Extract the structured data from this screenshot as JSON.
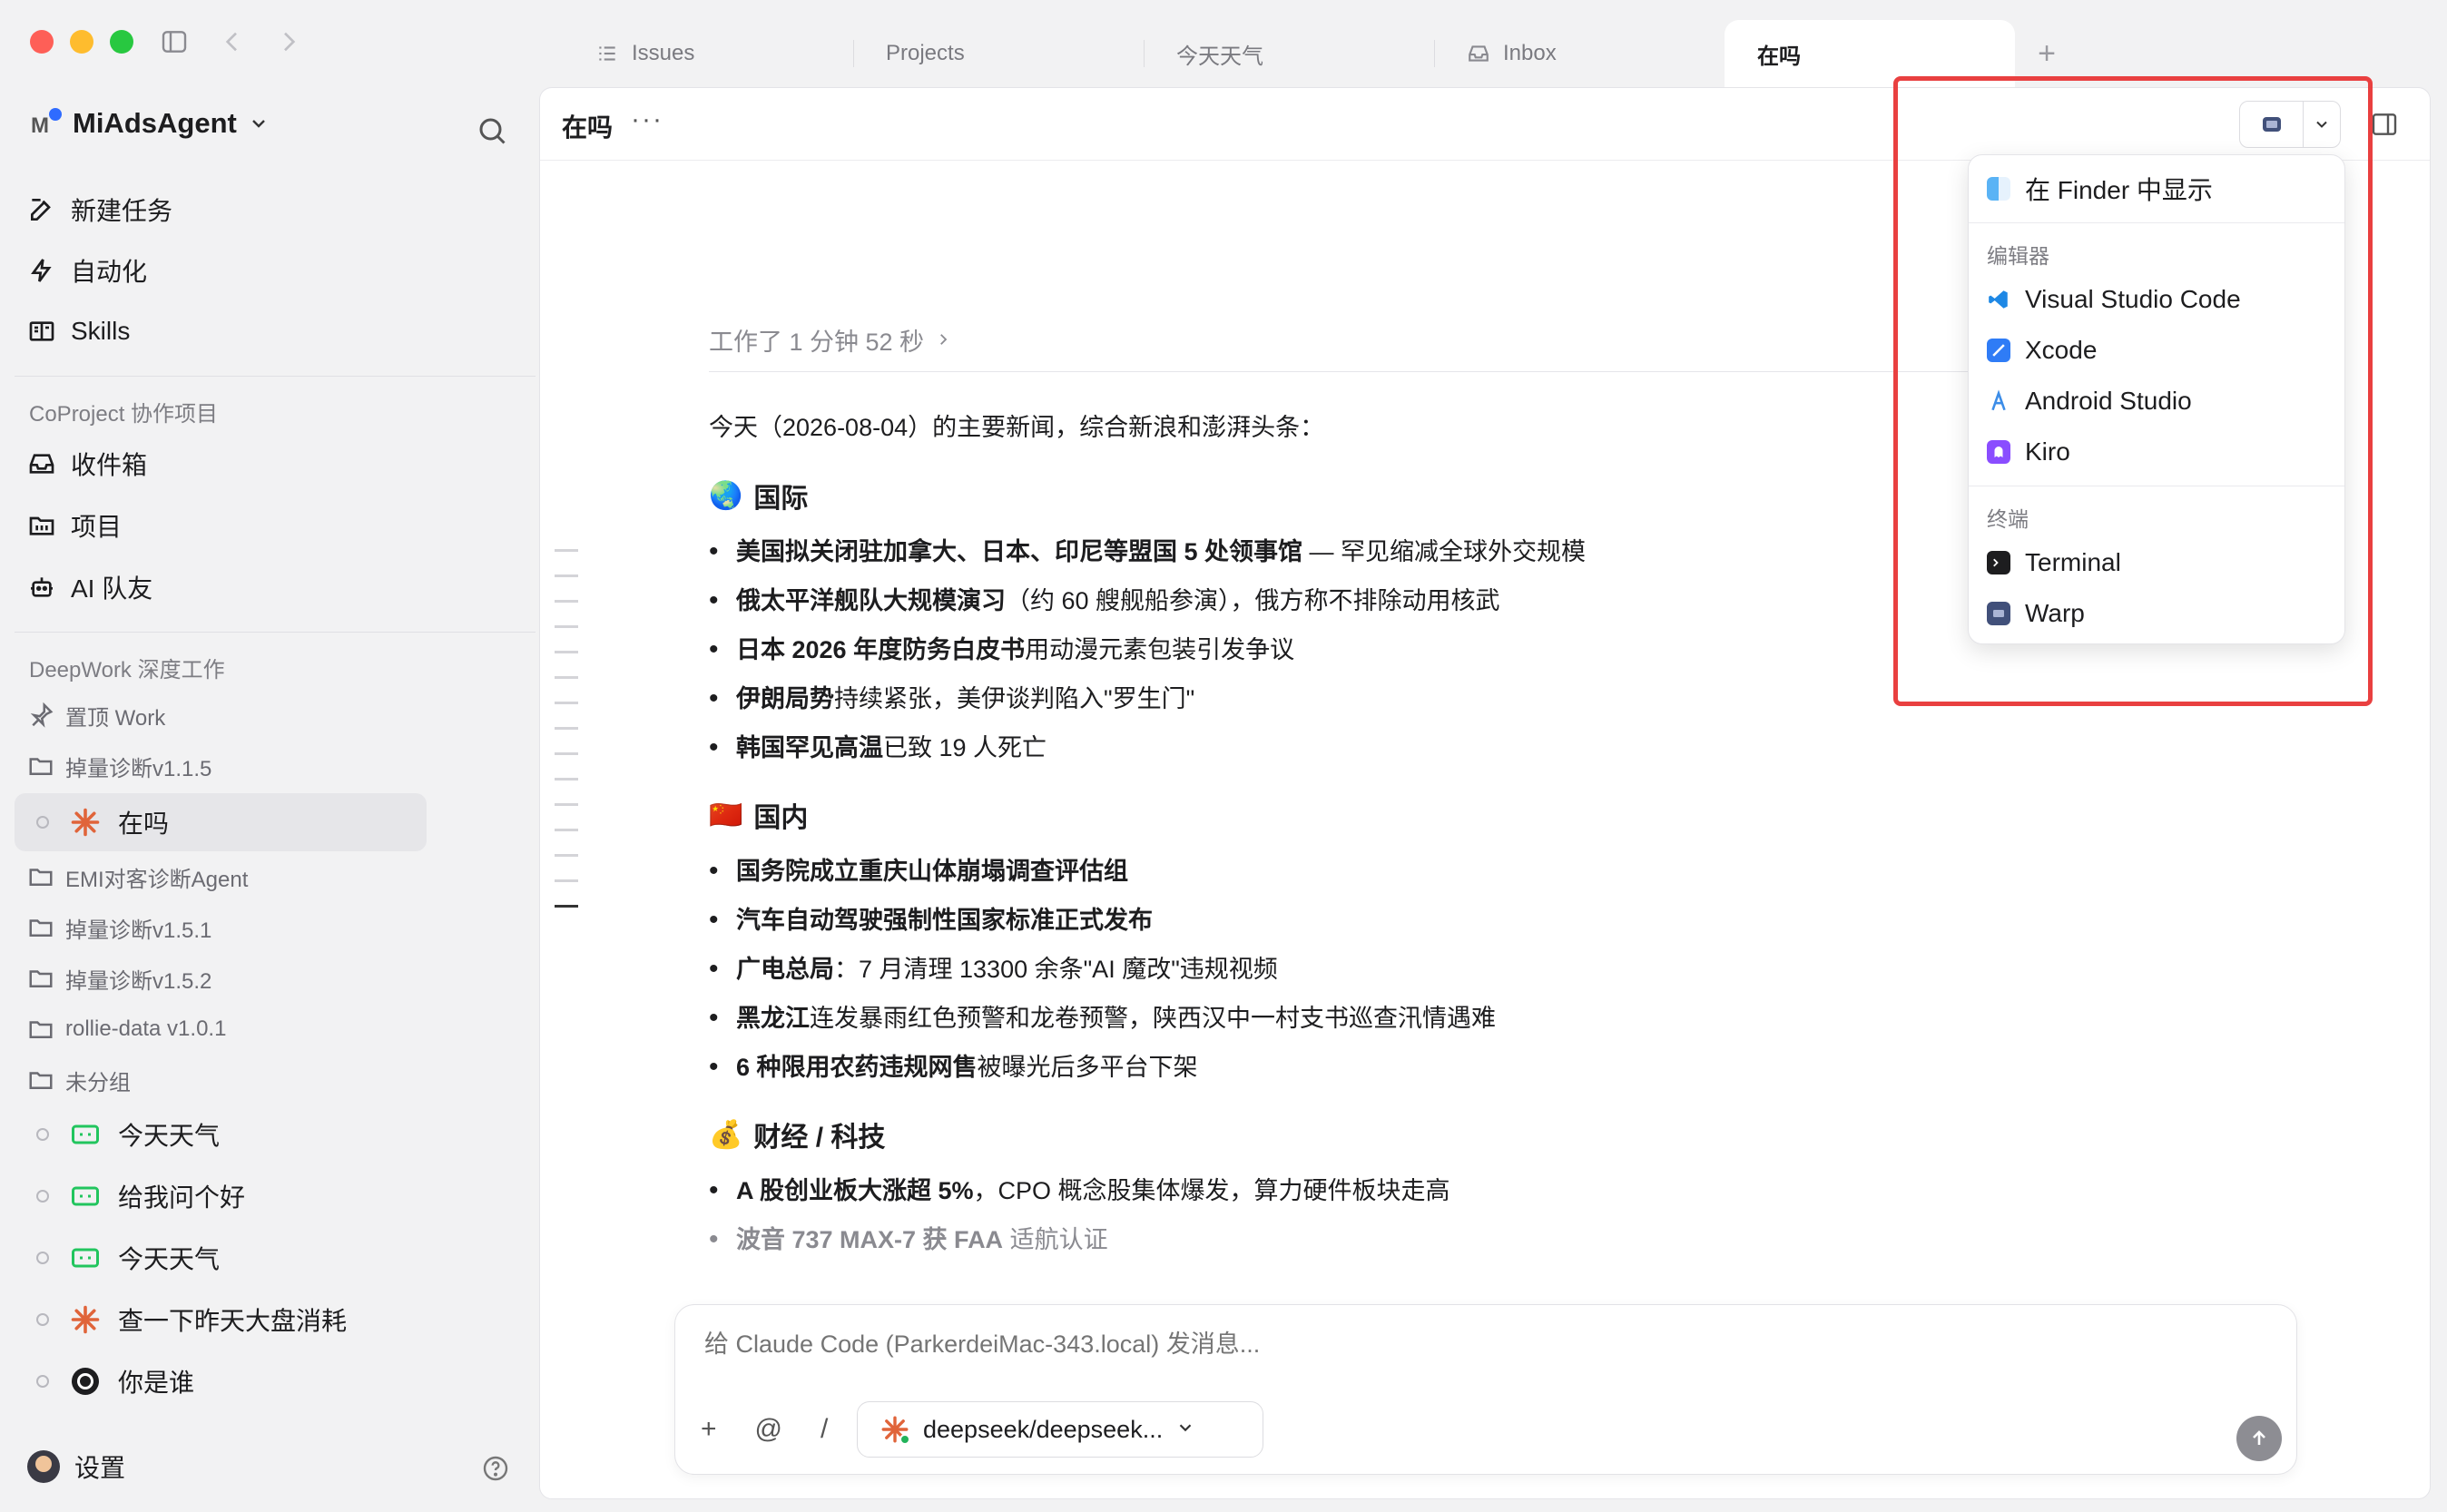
{
  "tabs": [
    {
      "label": "Issues",
      "icon": "list-icon"
    },
    {
      "label": "Projects",
      "icon": ""
    },
    {
      "label": "今天天气",
      "icon": ""
    },
    {
      "label": "Inbox",
      "icon": "inbox-icon"
    },
    {
      "label": "在吗",
      "icon": "",
      "active": true
    }
  ],
  "tab_add": "+",
  "sidebar": {
    "workspace_logo": "M",
    "workspace_name": "MiAdsAgent",
    "nav": [
      {
        "label": "新建任务",
        "icon": "edit-icon"
      },
      {
        "label": "自动化",
        "icon": "bolt-icon"
      },
      {
        "label": "Skills",
        "icon": "book-icon"
      }
    ],
    "coproject_label": "CoProject 协作项目",
    "coproject": [
      {
        "label": "收件箱",
        "icon": "inbox-icon"
      },
      {
        "label": "项目",
        "icon": "folder-grid-icon"
      },
      {
        "label": "AI 队友",
        "icon": "robot-icon"
      }
    ],
    "deepwork_label": "DeepWork 深度工作",
    "pinned": "置顶 Work",
    "groups_top": [
      "掉量诊断v1.1.5"
    ],
    "selected_chat": "在吗",
    "groups": [
      "EMI对客诊断Agent",
      "掉量诊断v1.5.1",
      "掉量诊断v1.5.2",
      "rollie-data v1.0.1",
      "未分组"
    ],
    "chats": [
      {
        "label": "今天天气",
        "icon": "bot-green-icon"
      },
      {
        "label": "给我问个好",
        "icon": "bot-green-icon"
      },
      {
        "label": "今天天气",
        "icon": "bot-green-icon"
      },
      {
        "label": "查一下昨天大盘消耗",
        "icon": "claude-icon"
      },
      {
        "label": "你是谁",
        "icon": "openai-icon"
      }
    ],
    "settings": "设置"
  },
  "main": {
    "title": "在吗",
    "more": "···",
    "worked": "工作了 1 分钟 52 秒",
    "intro": "今天（2026-08-04）的主要新闻，综合新浪和澎湃头条：",
    "sections": [
      {
        "emoji": "🌏",
        "title": "国际",
        "items": [
          {
            "bold": "美国拟关闭驻加拿大、日本、印尼等盟国 5 处领事馆",
            "rest": " — 罕见缩减全球外交规模"
          },
          {
            "bold": "俄太平洋舰队大规模演习",
            "rest": "（约 60 艘舰船参演），俄方称不排除动用核武"
          },
          {
            "bold": "日本 2026 年度防务白皮书",
            "rest": "用动漫元素包装引发争议"
          },
          {
            "bold": "伊朗局势",
            "rest": "持续紧张，美伊谈判陷入\"罗生门\""
          },
          {
            "bold": "韩国罕见高温",
            "rest": "已致 19 人死亡"
          }
        ]
      },
      {
        "emoji": "🇨🇳",
        "title": "国内",
        "items": [
          {
            "bold": "国务院成立重庆山体崩塌调查评估组",
            "rest": ""
          },
          {
            "bold": "汽车自动驾驶强制性国家标准正式发布",
            "rest": ""
          },
          {
            "bold": "广电总局",
            "rest": "：7 月清理 13300 余条\"AI 魔改\"违规视频"
          },
          {
            "bold": "黑龙江",
            "rest": "连发暴雨红色预警和龙卷预警，陕西汉中一村支书巡查汛情遇难"
          },
          {
            "bold": "6 种限用农药违规网售",
            "rest": "被曝光后多平台下架"
          }
        ]
      },
      {
        "emoji": "💰",
        "title": "财经 / 科技",
        "items": [
          {
            "bold": "A 股创业板大涨超 5%",
            "rest": "，CPO 概念股集体爆发，算力硬件板块走高"
          },
          {
            "bold": "波音 737 MAX-7 获 FAA",
            "rest": " 适航认证"
          }
        ]
      }
    ]
  },
  "composer": {
    "placeholder": "给 Claude Code (ParkerdeiMac-343.local) 发消息...",
    "tools": [
      "+",
      "@",
      "/"
    ],
    "model": "deepseek/deepseek..."
  },
  "dropdown": {
    "finder": "在 Finder 中显示",
    "editors_label": "编辑器",
    "editors": [
      {
        "label": "Visual Studio Code",
        "color": "#1e88e5"
      },
      {
        "label": "Xcode",
        "color": "#2f7cf6"
      },
      {
        "label": "Android Studio",
        "color": "#3c8de8"
      },
      {
        "label": "Kiro",
        "color": "#8a4dff"
      }
    ],
    "terminal_label": "终端",
    "terminals": [
      {
        "label": "Terminal",
        "color": "#1d1d1f"
      },
      {
        "label": "Warp",
        "color": "#41507a"
      }
    ]
  },
  "colors": {
    "accent_red": "#e94040",
    "brand_blue": "#2f6bff"
  }
}
